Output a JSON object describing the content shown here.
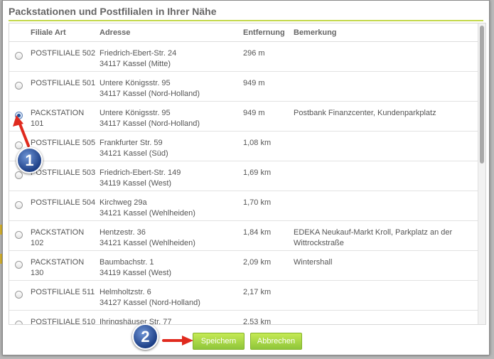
{
  "dialog": {
    "title": "Packstationen und Postfilialen in Ihrer Nähe"
  },
  "columns": {
    "art": "Filiale Art",
    "address": "Adresse",
    "distance": "Entfernung",
    "note": "Bemerkung"
  },
  "rows": [
    {
      "art_line1": "POSTFILIALE 502",
      "art_line2": "",
      "street": "Friedrich-Ebert-Str. 24",
      "city": "34117 Kassel  (Mitte)",
      "distance": "296 m",
      "note_line1": "",
      "note_line2": "",
      "selected": false
    },
    {
      "art_line1": "POSTFILIALE 501",
      "art_line2": "",
      "street": "Untere Königsstr. 95",
      "city": "34117 Kassel  (Nord-Holland)",
      "distance": "949 m",
      "note_line1": "",
      "note_line2": "",
      "selected": false
    },
    {
      "art_line1": "PACKSTATION",
      "art_line2": "101",
      "street": "Untere Königsstr. 95",
      "city": "34117 Kassel  (Nord-Holland)",
      "distance": "949 m",
      "note_line1": "Postbank Finanzcenter, Kundenparkplatz",
      "note_line2": "",
      "selected": true
    },
    {
      "art_line1": "POSTFILIALE 505",
      "art_line2": "",
      "street": "Frankfurter Str. 59",
      "city": "34121 Kassel  (Süd)",
      "distance": "1,08 km",
      "note_line1": "",
      "note_line2": "",
      "selected": false
    },
    {
      "art_line1": "POSTFILIALE 503",
      "art_line2": "",
      "street": "Friedrich-Ebert-Str. 149",
      "city": "34119 Kassel  (West)",
      "distance": "1,69 km",
      "note_line1": "",
      "note_line2": "",
      "selected": false
    },
    {
      "art_line1": "POSTFILIALE 504",
      "art_line2": "",
      "street": "Kirchweg 29a",
      "city": "34121 Kassel  (Wehlheiden)",
      "distance": "1,70 km",
      "note_line1": "",
      "note_line2": "",
      "selected": false
    },
    {
      "art_line1": "PACKSTATION",
      "art_line2": "102",
      "street": "Hentzestr. 36",
      "city": "34121 Kassel  (Wehlheiden)",
      "distance": "1,84 km",
      "note_line1": "EDEKA Neukauf-Markt Kroll, Parkplatz an der",
      "note_line2": "Wittrockstraße",
      "selected": false
    },
    {
      "art_line1": "PACKSTATION",
      "art_line2": "130",
      "street": "Baumbachstr. 1",
      "city": "34119 Kassel  (West)",
      "distance": "2,09 km",
      "note_line1": "Wintershall",
      "note_line2": "",
      "selected": false
    },
    {
      "art_line1": "POSTFILIALE 511",
      "art_line2": "",
      "street": "Helmholtzstr. 6",
      "city": "34127 Kassel  (Nord-Holland)",
      "distance": "2,17 km",
      "note_line1": "",
      "note_line2": "",
      "selected": false
    },
    {
      "art_line1": "POSTFILIALE 510",
      "art_line2": "",
      "street": "Ihringshäuser Str. 77",
      "city": "",
      "distance": "2,53 km",
      "note_line1": "",
      "note_line2": "",
      "selected": false
    }
  ],
  "buttons": {
    "save": "Speichern",
    "cancel": "Abbrechen"
  },
  "callouts": {
    "step1": "1",
    "step2": "2"
  },
  "colors": {
    "accent_green": "#9ccc3f",
    "title_rule": "#c3d84a",
    "badge_blue": "#1d3f86",
    "arrow_red": "#e02a1e"
  }
}
